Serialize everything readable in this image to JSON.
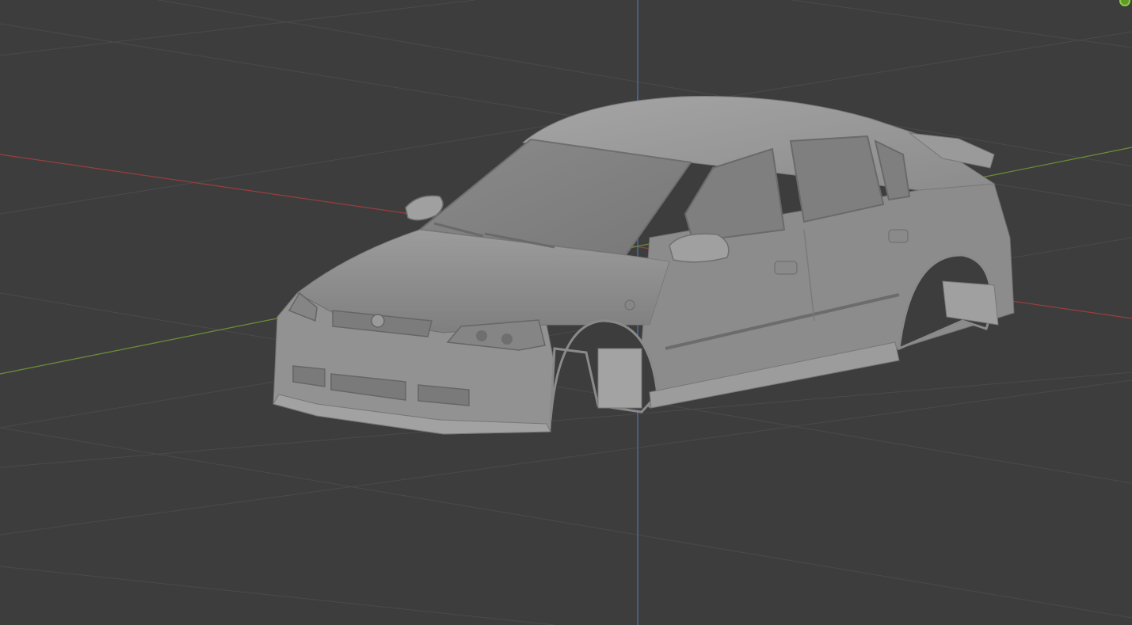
{
  "viewport": {
    "background": "#3d3d3d",
    "grid_color": "#4a4a4a",
    "axis_colors": {
      "x": "#9a3e3e",
      "y": "#6e8f3a",
      "z": "#4f74b3"
    },
    "object": {
      "name": "car-body",
      "body_color": "#8f8f8f"
    },
    "gizmo": {
      "icon": "navigation-gizmo-icon",
      "color": "#5f9a2a"
    }
  }
}
